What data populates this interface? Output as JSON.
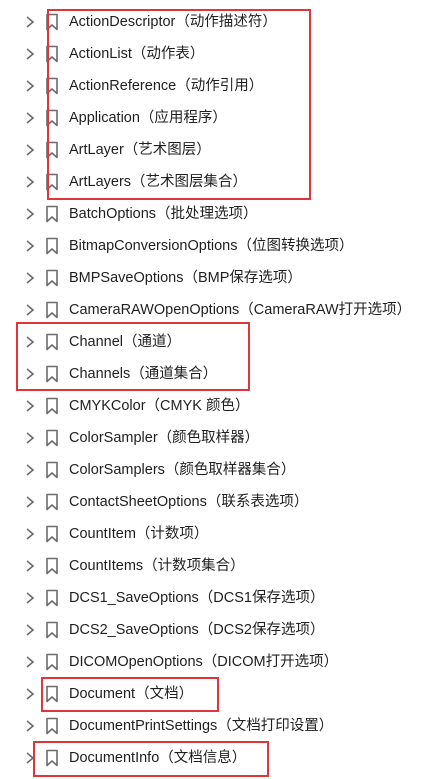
{
  "bookmarks": [
    {
      "label": "ActionDescriptor（动作描述符）"
    },
    {
      "label": "ActionList（动作表）"
    },
    {
      "label": "ActionReference（动作引用）"
    },
    {
      "label": "Application（应用程序）"
    },
    {
      "label": "ArtLayer（艺术图层）"
    },
    {
      "label": "ArtLayers（艺术图层集合）"
    },
    {
      "label": "BatchOptions（批处理选项）"
    },
    {
      "label": "BitmapConversionOptions（位图转换选项）"
    },
    {
      "label": "BMPSaveOptions（BMP保存选项）"
    },
    {
      "label": "CameraRAWOpenOptions（CameraRAW打开选项）"
    },
    {
      "label": "Channel（通道）"
    },
    {
      "label": "Channels（通道集合）"
    },
    {
      "label": "CMYKColor（CMYK 颜色）"
    },
    {
      "label": "ColorSampler（颜色取样器）"
    },
    {
      "label": "ColorSamplers（颜色取样器集合）"
    },
    {
      "label": "ContactSheetOptions（联系表选项）"
    },
    {
      "label": "CountItem（计数项）"
    },
    {
      "label": "CountItems（计数项集合）"
    },
    {
      "label": "DCS1_SaveOptions（DCS1保存选项）"
    },
    {
      "label": "DCS2_SaveOptions（DCS2保存选项）"
    },
    {
      "label": "DICOMOpenOptions（DICOM打开选项）"
    },
    {
      "label": "Document（文档）"
    },
    {
      "label": "DocumentPrintSettings（文档打印设置）"
    },
    {
      "label": "DocumentInfo（文档信息）"
    }
  ],
  "colors": {
    "highlight": "#e0353b",
    "icon": "#6b6b6b",
    "text": "#1f1f1f"
  },
  "icons": {
    "expander": "chevron-right-icon",
    "item": "bookmark-icon"
  }
}
